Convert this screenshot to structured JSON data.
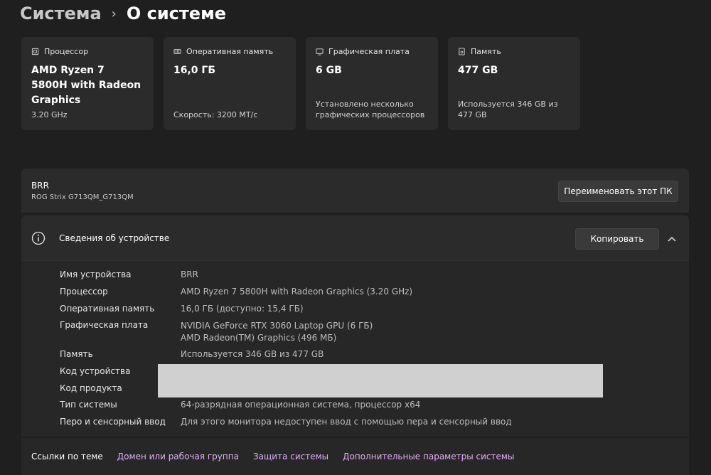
{
  "breadcrumb": {
    "parent": "Система",
    "separator": "›",
    "current": "О системе"
  },
  "cards": [
    {
      "icon": "processor-icon",
      "title": "Процессор",
      "value": "AMD Ryzen 7 5800H with Radeon Graphics",
      "note": "3.20 GHz"
    },
    {
      "icon": "memory-icon",
      "title": "Оперативная память",
      "value": "16,0 ГБ",
      "note": "Скорость: 3200 МТ/с"
    },
    {
      "icon": "gpu-icon",
      "title": "Графическая плата",
      "value": "6 GB",
      "note": "Установлено несколько графических процессоров"
    },
    {
      "icon": "storage-icon",
      "title": "Память",
      "value": "477 GB",
      "note": "Используется 346 GB из 477 GB"
    }
  ],
  "device": {
    "name": "BRR",
    "model": "ROG Strix G713QM_G713QM",
    "rename_label": "Переименовать этот ПК"
  },
  "details": {
    "title": "Сведения об устройстве",
    "copy_label": "Копировать",
    "rows": [
      {
        "label": "Имя устройства",
        "value": "BRR"
      },
      {
        "label": "Процессор",
        "value": "AMD Ryzen 7 5800H with Radeon Graphics (3.20 GHz)"
      },
      {
        "label": "Оперативная память",
        "value": "16,0 ГБ (доступно: 15,4 ГБ)"
      },
      {
        "label": "Графическая плата",
        "value": "NVIDIA GeForce RTX 3060 Laptop GPU (6 ГБ)",
        "value2": "AMD Radeon(TM) Graphics (496 МБ)"
      },
      {
        "label": "Память",
        "value": "Используется 346 GB из 477 GB"
      },
      {
        "label": "Код устройства",
        "value": ""
      },
      {
        "label": "Код продукта",
        "value": ""
      },
      {
        "label": "Тип системы",
        "value": "64-разрядная операционная система, процессор x64"
      },
      {
        "label": "Перо и сенсорный ввод",
        "value": "Для этого монитора недоступен ввод с помощью пера и сенсорный ввод"
      }
    ]
  },
  "links": {
    "label": "Ссылки по теме",
    "items": [
      "Домен или рабочая группа",
      "Защита системы",
      "Дополнительные параметры системы"
    ]
  },
  "colors": {
    "background": "#1f1f1f",
    "card": "#2b2b2b",
    "link": "#e3aef5"
  }
}
